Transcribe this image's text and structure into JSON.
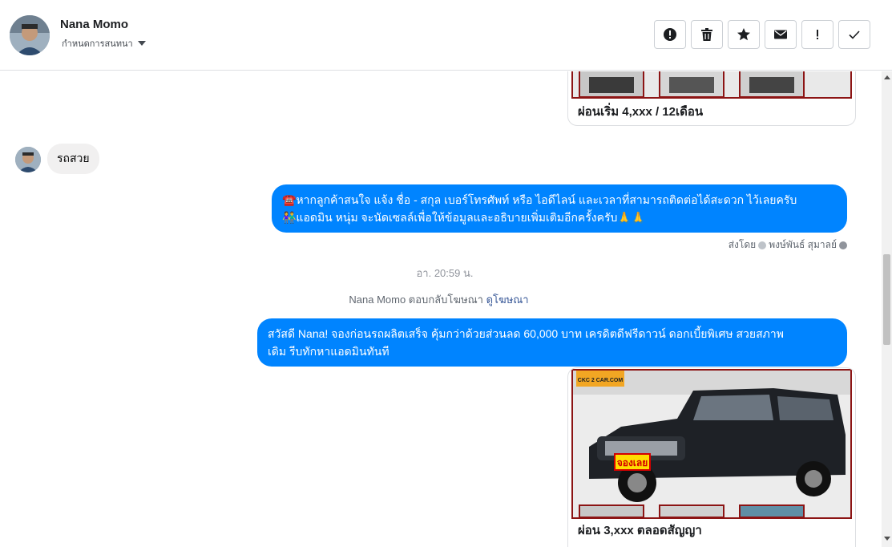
{
  "header": {
    "name": "Nana Momo",
    "subtitle": "กำหนดการสนทนา",
    "actions": [
      {
        "icon": "alert-circle-icon",
        "label": "Mark as spam"
      },
      {
        "icon": "trash-icon",
        "label": "Delete"
      },
      {
        "icon": "star-icon",
        "label": "Star"
      },
      {
        "icon": "envelope-icon",
        "label": "Mark as unread"
      },
      {
        "icon": "exclamation-icon",
        "label": "Follow up"
      },
      {
        "icon": "check-icon",
        "label": "Done"
      }
    ]
  },
  "messages": {
    "top_card_caption": "ผ่อนเริ่ม 4,xxx / 12เดือน",
    "incoming_text": "รถสวย",
    "outgoing_1_line1": "☎️หากลูกค้าสนใจ แจ้ง ชื่อ - สกุล เบอร์โทรศัพท์ หรือ ไอดีไลน์ และเวลาที่สามารถติดต่อได้สะดวก ไว้เลยครับ",
    "outgoing_1_line2": "👫แอดมิน หนุ่ม จะนัดเซลล์เพื่อให้ข้อมูลและอธิบายเพิ่มเติมอีกครั้งครับ🙏🙏",
    "sent_by_label": "ส่งโดย",
    "sent_by_name": "พงษ์พันธ์ สุมาลย์",
    "timestamp": "อา. 20:59 น.",
    "reply_note": "Nana Momo ตอบกลับโฆษณา",
    "reply_link": "ดูโฆษณา",
    "outgoing_2_line1": "สวัสดี Nana! จองก่อนรถผลิตเสร็จ คุ้มกว่าด้วยส่วนลด 60,000 บาท เครดิตดีฟรีดาวน์ ดอกเบี้ยพิเศษ สวยสภาพ",
    "outgoing_2_line2": "เดิม รีบทักหาแอดมินทันที",
    "bottom_card_logo": "CKC 2 CAR.COM",
    "bottom_card_badge": "จองเลย",
    "bottom_card_caption": "ผ่อน 3,xxx ตลอดสัญญา"
  },
  "colors": {
    "outgoing_bubble": "#0084ff",
    "incoming_bubble": "#f1f0f0",
    "link": "#385898"
  }
}
